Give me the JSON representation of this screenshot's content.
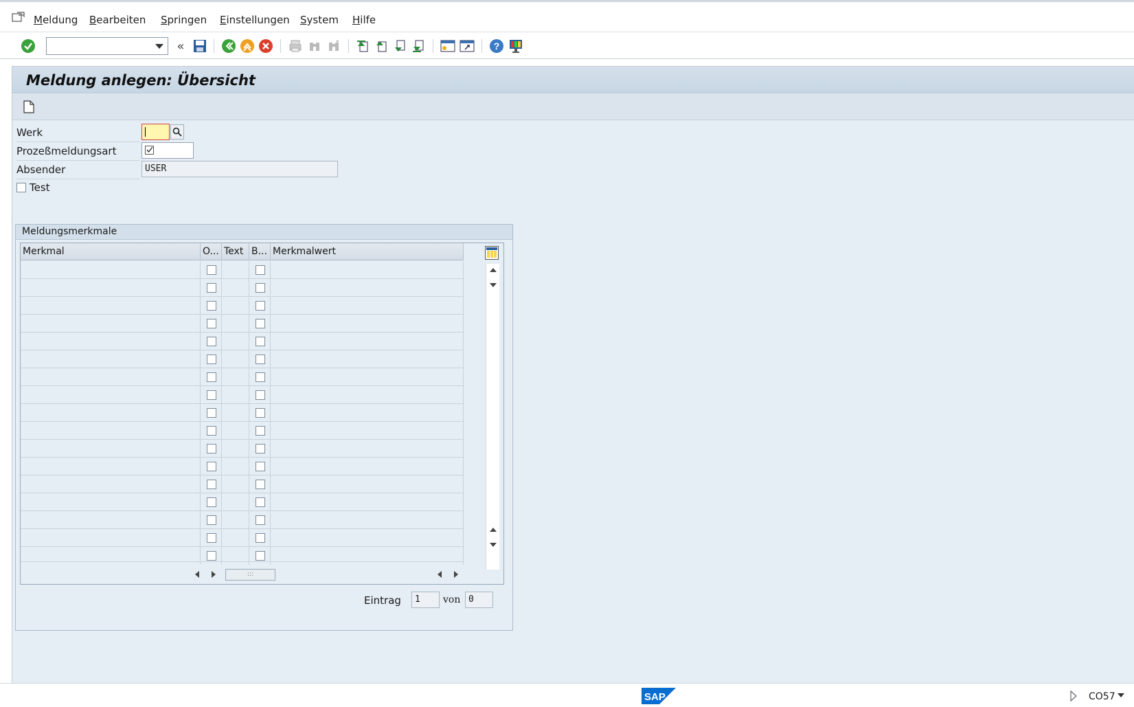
{
  "menu": {
    "items": [
      {
        "label": "Meldung",
        "underline": "M",
        "rest": "eldung"
      },
      {
        "label": "Bearbeiten",
        "underline": "B",
        "rest": "earbeiten"
      },
      {
        "label": "Springen",
        "underline": "S",
        "rest": "pringen"
      },
      {
        "label": "Einstellungen",
        "underline": "E",
        "rest": "instellungen"
      },
      {
        "label": "System",
        "underline": "S",
        "rest": "ystem"
      },
      {
        "label": "Hilfe",
        "underline": "H",
        "rest": "ilfe"
      }
    ]
  },
  "toolbar": {
    "command_field_value": "",
    "icons": [
      "enter-icon",
      "command-dropdown",
      "double-left-icon",
      "save-icon",
      "back-icon",
      "exit-icon",
      "cancel-icon",
      "print-icon",
      "find-icon",
      "find-next-icon",
      "first-page-icon",
      "previous-page-icon",
      "next-page-icon",
      "last-page-icon",
      "new-session-icon",
      "shortcut-icon",
      "help-icon",
      "customize-layout-icon"
    ]
  },
  "page": {
    "title": "Meldung anlegen: Übersicht"
  },
  "form": {
    "werk_label": "Werk",
    "werk_value": "",
    "prozessmeldungsart_label": "Prozeßmeldungsart",
    "prozessmeldungsart_value": "",
    "absender_label": "Absender",
    "absender_value": "USER",
    "test_label": "Test",
    "test_checked": false
  },
  "group": {
    "title": "Meldungsmerkmale",
    "columns": [
      "Merkmal",
      "O...",
      "Text",
      "B...",
      "Merkmalwert"
    ],
    "row_count": 17,
    "entry_label": "Eintrag",
    "entry_value": "1",
    "of_label": "von",
    "of_value": "0"
  },
  "status": {
    "tcode": "CO57"
  },
  "colors": {
    "brand_blue": "#0a6ed1",
    "background": "#e6eef5",
    "required_field": "#fff6b0"
  }
}
